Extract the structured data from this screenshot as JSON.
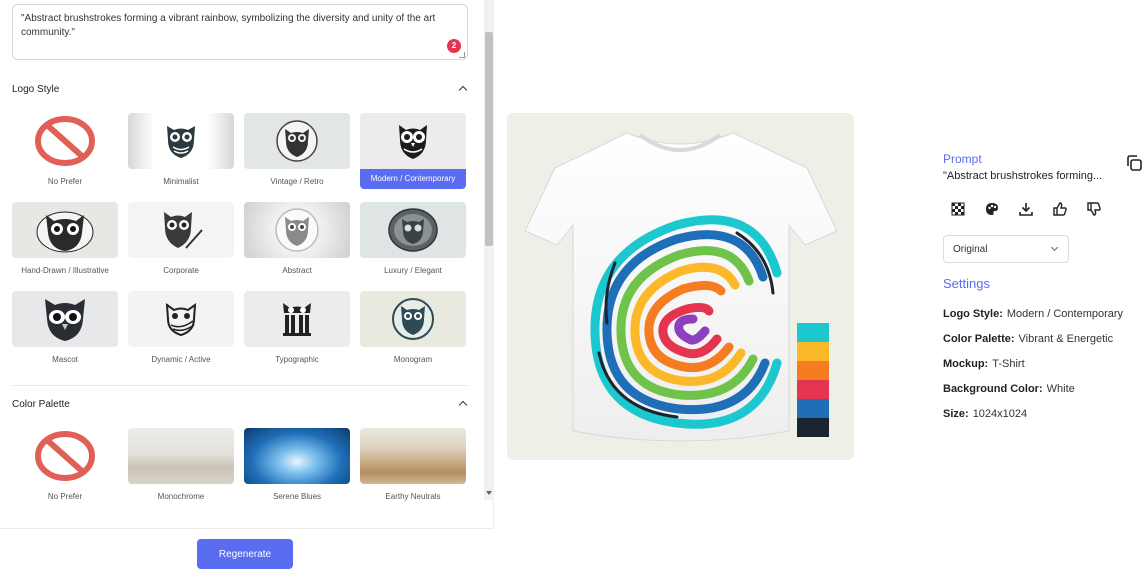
{
  "left_panel": {
    "prompt_text": "\"Abstract brushstrokes forming a vibrant rainbow, symbolizing the diversity and unity of the art community.\"",
    "badge_count": "2",
    "logo_style": {
      "title": "Logo Style",
      "items": [
        {
          "label": "No Prefer"
        },
        {
          "label": "Minimalist"
        },
        {
          "label": "Vintage / Retro"
        },
        {
          "label": "Modern / Contemporary",
          "selected": true
        },
        {
          "label": "Hand-Drawn / Illustrative"
        },
        {
          "label": "Corporate"
        },
        {
          "label": "Abstract"
        },
        {
          "label": "Luxury / Elegant"
        },
        {
          "label": "Mascot"
        },
        {
          "label": "Dynamic / Active"
        },
        {
          "label": "Typographic"
        },
        {
          "label": "Monogram"
        }
      ]
    },
    "color_palette": {
      "title": "Color Palette",
      "items": [
        {
          "label": "No Prefer"
        },
        {
          "label": "Monochrome"
        },
        {
          "label": "Serene Blues"
        },
        {
          "label": "Earthy Neutrals"
        }
      ]
    },
    "regenerate_label": "Regenerate"
  },
  "right_panel": {
    "prompt_label": "Prompt",
    "prompt_snippet": "\"Abstract brushstrokes forming...",
    "version_select": "Original",
    "settings_label": "Settings",
    "settings": {
      "logo_style": {
        "key": "Logo Style:",
        "value": "Modern / Contemporary"
      },
      "color_palette": {
        "key": "Color Palette:",
        "value": "Vibrant & Energetic"
      },
      "mockup": {
        "key": "Mockup:",
        "value": "T-Shirt"
      },
      "background_color": {
        "key": "Background Color:",
        "value": "White"
      },
      "size": {
        "key": "Size:",
        "value": "1024x1024"
      }
    }
  },
  "colors": {
    "accent": "#5a6cf1",
    "badge": "#e5344f",
    "swatches": [
      "#1cc7d0",
      "#fbb829",
      "#f57c20",
      "#e5344f",
      "#1f6fb8",
      "#1c2430"
    ]
  }
}
